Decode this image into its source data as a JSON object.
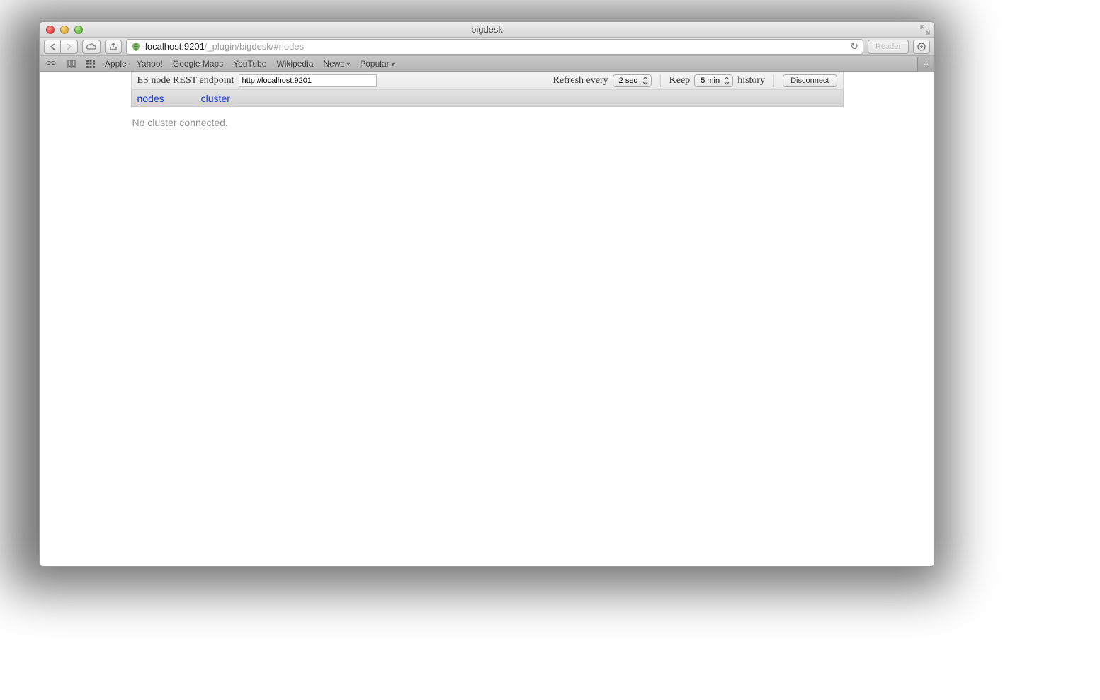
{
  "window": {
    "title": "bigdesk"
  },
  "url": {
    "host": "localhost:9201",
    "path": "/_plugin/bigdesk/#nodes"
  },
  "toolbar": {
    "reader_label": "Reader"
  },
  "bookmarks": {
    "items": [
      {
        "label": "Apple",
        "dropdown": false
      },
      {
        "label": "Yahoo!",
        "dropdown": false
      },
      {
        "label": "Google Maps",
        "dropdown": false
      },
      {
        "label": "YouTube",
        "dropdown": false
      },
      {
        "label": "Wikipedia",
        "dropdown": false
      },
      {
        "label": "News",
        "dropdown": true
      },
      {
        "label": "Popular",
        "dropdown": true
      }
    ]
  },
  "app": {
    "endpoint_label": "ES node REST endpoint",
    "endpoint_value": "http://localhost:9201",
    "refresh_label": "Refresh every",
    "refresh_selected": "2 sec",
    "keep_label": "Keep",
    "keep_selected": "5 min",
    "history_label": "history",
    "disconnect_label": "Disconnect",
    "tabs": {
      "nodes": "nodes",
      "cluster": "cluster"
    },
    "status_message": "No cluster connected."
  }
}
